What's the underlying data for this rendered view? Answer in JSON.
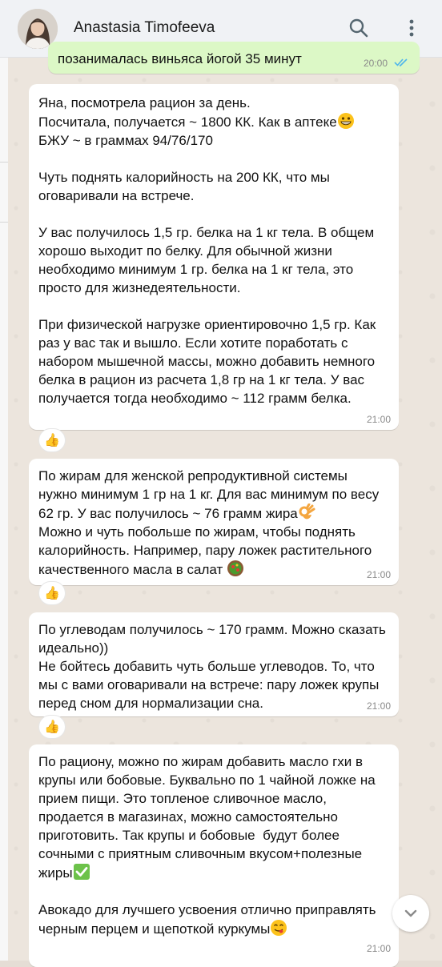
{
  "header": {
    "contact_name": "Anastasia Timofeeva"
  },
  "icons": {
    "search": "search-icon",
    "menu": "more-vertical-icon",
    "read_receipt": "double-check-icon",
    "reaction": "thumbs-up-icon",
    "scroll": "chevron-down-icon"
  },
  "colors": {
    "chat_background": "#ece5dd",
    "incoming_bubble": "#ffffff",
    "outgoing_bubble": "#dcf8c6",
    "read_ticks": "#4fb6ec"
  },
  "messages": [
    {
      "direction": "outgoing",
      "text": "позанималась виньяса йогой 35 минут",
      "time": "20:00"
    },
    {
      "direction": "incoming",
      "paragraphs": [
        "Яна, посмотрела рацион за день.\nПосчитала, получается ~ 1800 КК. Как в аптеке",
        "БЖУ ~ в граммах 94/76/170\n\nЧуть поднять калорийность на 200 КК, что мы оговаривали на встрече.\n\nУ вас получилось 1,5 гр. белка на 1 кг тела. В общем хорошо выходит по белку. Для обычной жизни необходимо минимум 1 гр. белка на 1 кг тела, это просто для жизнедеятельности.\n\nПри физической нагрузке ориентировочно 1,5 гр. Как раз у вас так и вышло. Если хотите поработать с набором мышечной массы, можно добавить немного белка в рацион из расчета 1,8 гр на 1 кг тела. У вас получается тогда необходимо ~ 112 грамм белка."
      ],
      "time": "21:00",
      "reaction": "👍"
    },
    {
      "direction": "incoming",
      "paragraphs": [
        "По жирам для женской репродуктивной системы нужно минимум 1 гр на 1 кг. Для вас минимум по весу 62 гр. У вас получилось ~ 76 грамм жира",
        "\nМожно и чуть побольше по жирам, чтобы поднять калорийность. Например, пару ложек растительного качественного масла в салат "
      ],
      "time": "21:00",
      "reaction": "👍"
    },
    {
      "direction": "incoming",
      "paragraphs": [
        "По углеводам получилось ~ 170 грамм. Можно сказать идеально))\nНе бойтесь добавить чуть больше углеводов. То, что мы с вами оговаривали на встрече: пару ложек крупы перед сном для нормализации сна."
      ],
      "time": "21:00",
      "reaction": "👍"
    },
    {
      "direction": "incoming",
      "paragraphs": [
        "По рациону, можно по жирам добавить масло гхи в крупы или бобовые. Буквально по 1 чайной ложке на прием пищи. Это топленое сливочное масло, продается в магазинах, можно самостоятельно приготовить. Так крупы и бобовые  будут более сочными с приятным сливочным вкусом+полезные жиры",
        "\n\nАвокадо для лучшего усвоения отлично приправлять черным перцем и щепоткой куркумы"
      ],
      "time": "21:00"
    }
  ]
}
